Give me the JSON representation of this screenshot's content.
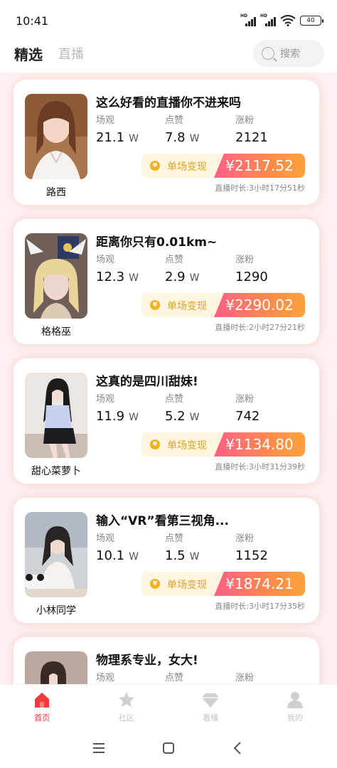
{
  "status_bar": {
    "time": "10:41",
    "battery": "40",
    "signal_label": "HD"
  },
  "top_nav": {
    "tab_selected": "精选",
    "tab_live": "直播",
    "search_placeholder": "搜索"
  },
  "card_labels": {
    "views": "场观",
    "likes": "点赞",
    "fans": "涨粉",
    "monetize": "单场变现",
    "unit_w": "W"
  },
  "cards": [
    {
      "title": "这么好看的直播你不进来吗",
      "name": "路西",
      "views": "21.1",
      "likes": "7.8",
      "fans": "2121",
      "amount": "¥2117.52",
      "duration": "直播时长:3小时17分51秒"
    },
    {
      "title": "距离你只有0.01km~",
      "name": "格格巫",
      "views": "12.3",
      "likes": "2.9",
      "fans": "1290",
      "amount": "¥2290.02",
      "duration": "直播时长:2小时27分21秒"
    },
    {
      "title": "这真的是四川甜妹!",
      "name": "甜心菜萝卜",
      "views": "11.9",
      "likes": "5.2",
      "fans": "742",
      "amount": "¥1134.80",
      "duration": "直播时长:3小时31分39秒"
    },
    {
      "title": "输入“VR”看第三视角...",
      "name": "小林同学",
      "views": "10.1",
      "likes": "1.5",
      "fans": "1152",
      "amount": "¥1874.21",
      "duration": "直播时长:3小时17分35秒"
    },
    {
      "title": "物理系专业，女大!"
    }
  ],
  "tab_bar": {
    "home": "首页",
    "community": "社区",
    "watch": "看播",
    "mine": "我的"
  },
  "colors": {
    "accent": "#ef3b3b",
    "gradient_start": "#ff5f87",
    "gradient_end": "#ffa23d",
    "monetize_bg": "#fff6e0",
    "monetize_text": "#e0a22a"
  }
}
